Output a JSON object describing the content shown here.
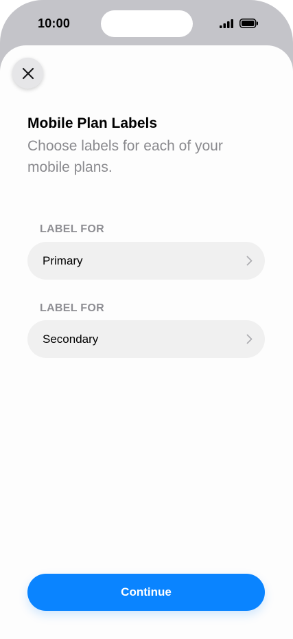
{
  "status_bar": {
    "time": "10:00",
    "icons": [
      "signal-icon",
      "battery-icon"
    ]
  },
  "sheet": {
    "close_icon": "close-icon",
    "title": "Mobile Plan Labels",
    "subtitle": "Choose labels for each of your mobile plans.",
    "sections": [
      {
        "header": "LABEL FOR",
        "value": "Primary",
        "chevron": "chevron-right-icon"
      },
      {
        "header": "LABEL FOR",
        "value": "Secondary",
        "chevron": "chevron-right-icon"
      }
    ],
    "continue_label": "Continue"
  },
  "colors": {
    "accent": "#0A84FF",
    "status_bar_bg": "#C4C4C9",
    "row_bg": "#F0F0F0",
    "secondary_text": "#8A8A8E"
  }
}
